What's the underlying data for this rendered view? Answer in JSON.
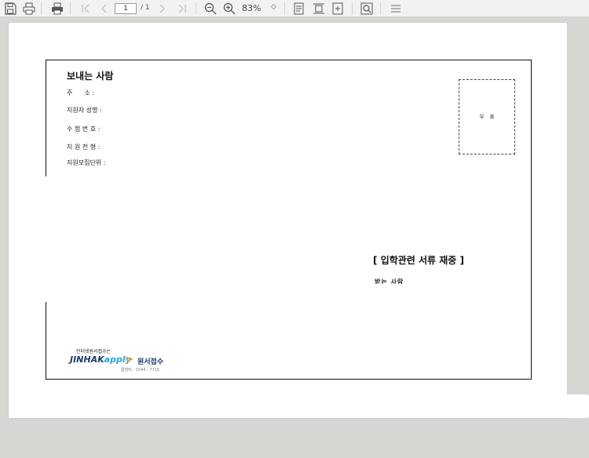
{
  "toolbar": {
    "page_current": "1",
    "page_total": "/ 1",
    "zoom": "83%",
    "zoom_caret": "◇"
  },
  "document": {
    "sender_title": "보내는 사람",
    "fields": [
      {
        "label": "주      소 :"
      },
      {
        "label": "지원자 성명 :"
      },
      {
        "label": "수 험 번 호 :"
      },
      {
        "label": "지 원 전 형 :"
      },
      {
        "label": "지원모집단위 :"
      }
    ],
    "stamp_label": "우   표",
    "receiver_title": "[ 입학관련 서류 재중 ]",
    "receiver_sub": "받는 사람"
  },
  "logo": {
    "tagline": "인터넷원서접수는",
    "brand_prefix": "JINHAK",
    "brand_suffix": "apply",
    "service": "원서접수",
    "phone": "콜센터 : 1544 - 7715"
  },
  "colors": {
    "toolbar_bg": "#f2f2f1",
    "workspace_bg": "#d6d6d3",
    "brand_navy": "#1b3a6b",
    "brand_blue": "#2aa3d6",
    "brand_orange": "#f2a31a"
  }
}
